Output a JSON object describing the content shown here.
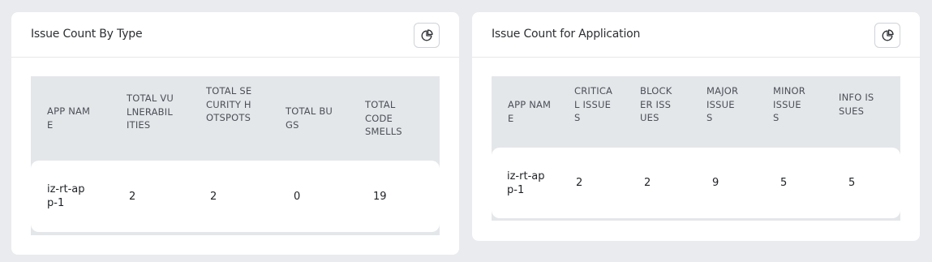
{
  "panels": [
    {
      "title": "Issue Count By Type",
      "columns": [
        "APP NAME",
        "TOTAL VULNERABILITIES",
        "TOTAL SECURITY HOTSPOTS",
        "TOTAL BUGS",
        "TOTAL CODE SMELLS"
      ],
      "rows": [
        [
          "iz-rt-app-1",
          "2",
          "2",
          "0",
          "19"
        ]
      ],
      "icon": "pie-chart-icon"
    },
    {
      "title": "Issue Count for Application",
      "columns": [
        "APP NAME",
        "CRITICAL ISSUES",
        "BLOCKER ISSUES",
        "MAJOR ISSUES",
        "MINOR ISSUES",
        "INFO ISSUES"
      ],
      "rows": [
        [
          "iz-rt-app-1",
          "2",
          "2",
          "9",
          "5",
          "5"
        ]
      ],
      "icon": "pie-chart-icon"
    }
  ]
}
